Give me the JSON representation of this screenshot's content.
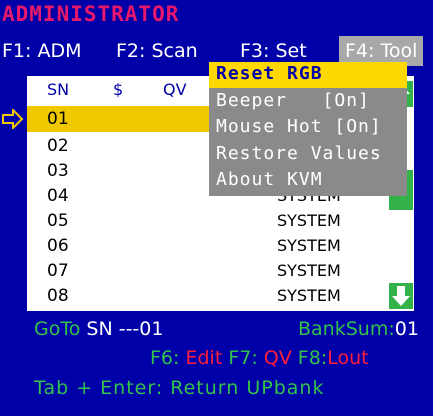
{
  "title": "ADMINISTRATOR",
  "function_keys": [
    {
      "label": "F1: ADM"
    },
    {
      "label": "F2: Scan"
    },
    {
      "label": "F3: Set"
    },
    {
      "label": "F4: Tool"
    }
  ],
  "columns": {
    "sn": "SN",
    "dollar": "$",
    "qv": "QV"
  },
  "rows": [
    {
      "sn": "01",
      "name": ""
    },
    {
      "sn": "02",
      "name": ""
    },
    {
      "sn": "03",
      "name": ""
    },
    {
      "sn": "04",
      "name": "SYSTEM"
    },
    {
      "sn": "05",
      "name": "SYSTEM"
    },
    {
      "sn": "06",
      "name": "SYSTEM"
    },
    {
      "sn": "07",
      "name": "SYSTEM"
    },
    {
      "sn": "08",
      "name": "SYSTEM"
    }
  ],
  "tools_menu": {
    "items": [
      {
        "label": "Reset RGB"
      },
      {
        "label": "Beeper   [On]"
      },
      {
        "label": "Mouse Hot [On]"
      },
      {
        "label": "Restore Values"
      },
      {
        "label": "About KVM"
      }
    ]
  },
  "status": {
    "goto_label": "GoTo",
    "goto_value": "SN ---01",
    "banksum_label": "BankSum:",
    "banksum_value": "01",
    "f6_key": "F6:",
    "f6_action": "Edit",
    "f7_key": "F7:",
    "f7_action": "QV",
    "f8_key": "F8:",
    "f8_action": "Lout",
    "hint": "Tab + Enter: Return UPbank"
  },
  "colors": {
    "background": "#0000a8",
    "title": "#e8186b",
    "highlight": "#f0c800",
    "accent_green": "#33c24a",
    "menu_gray": "#8a8a8a"
  }
}
